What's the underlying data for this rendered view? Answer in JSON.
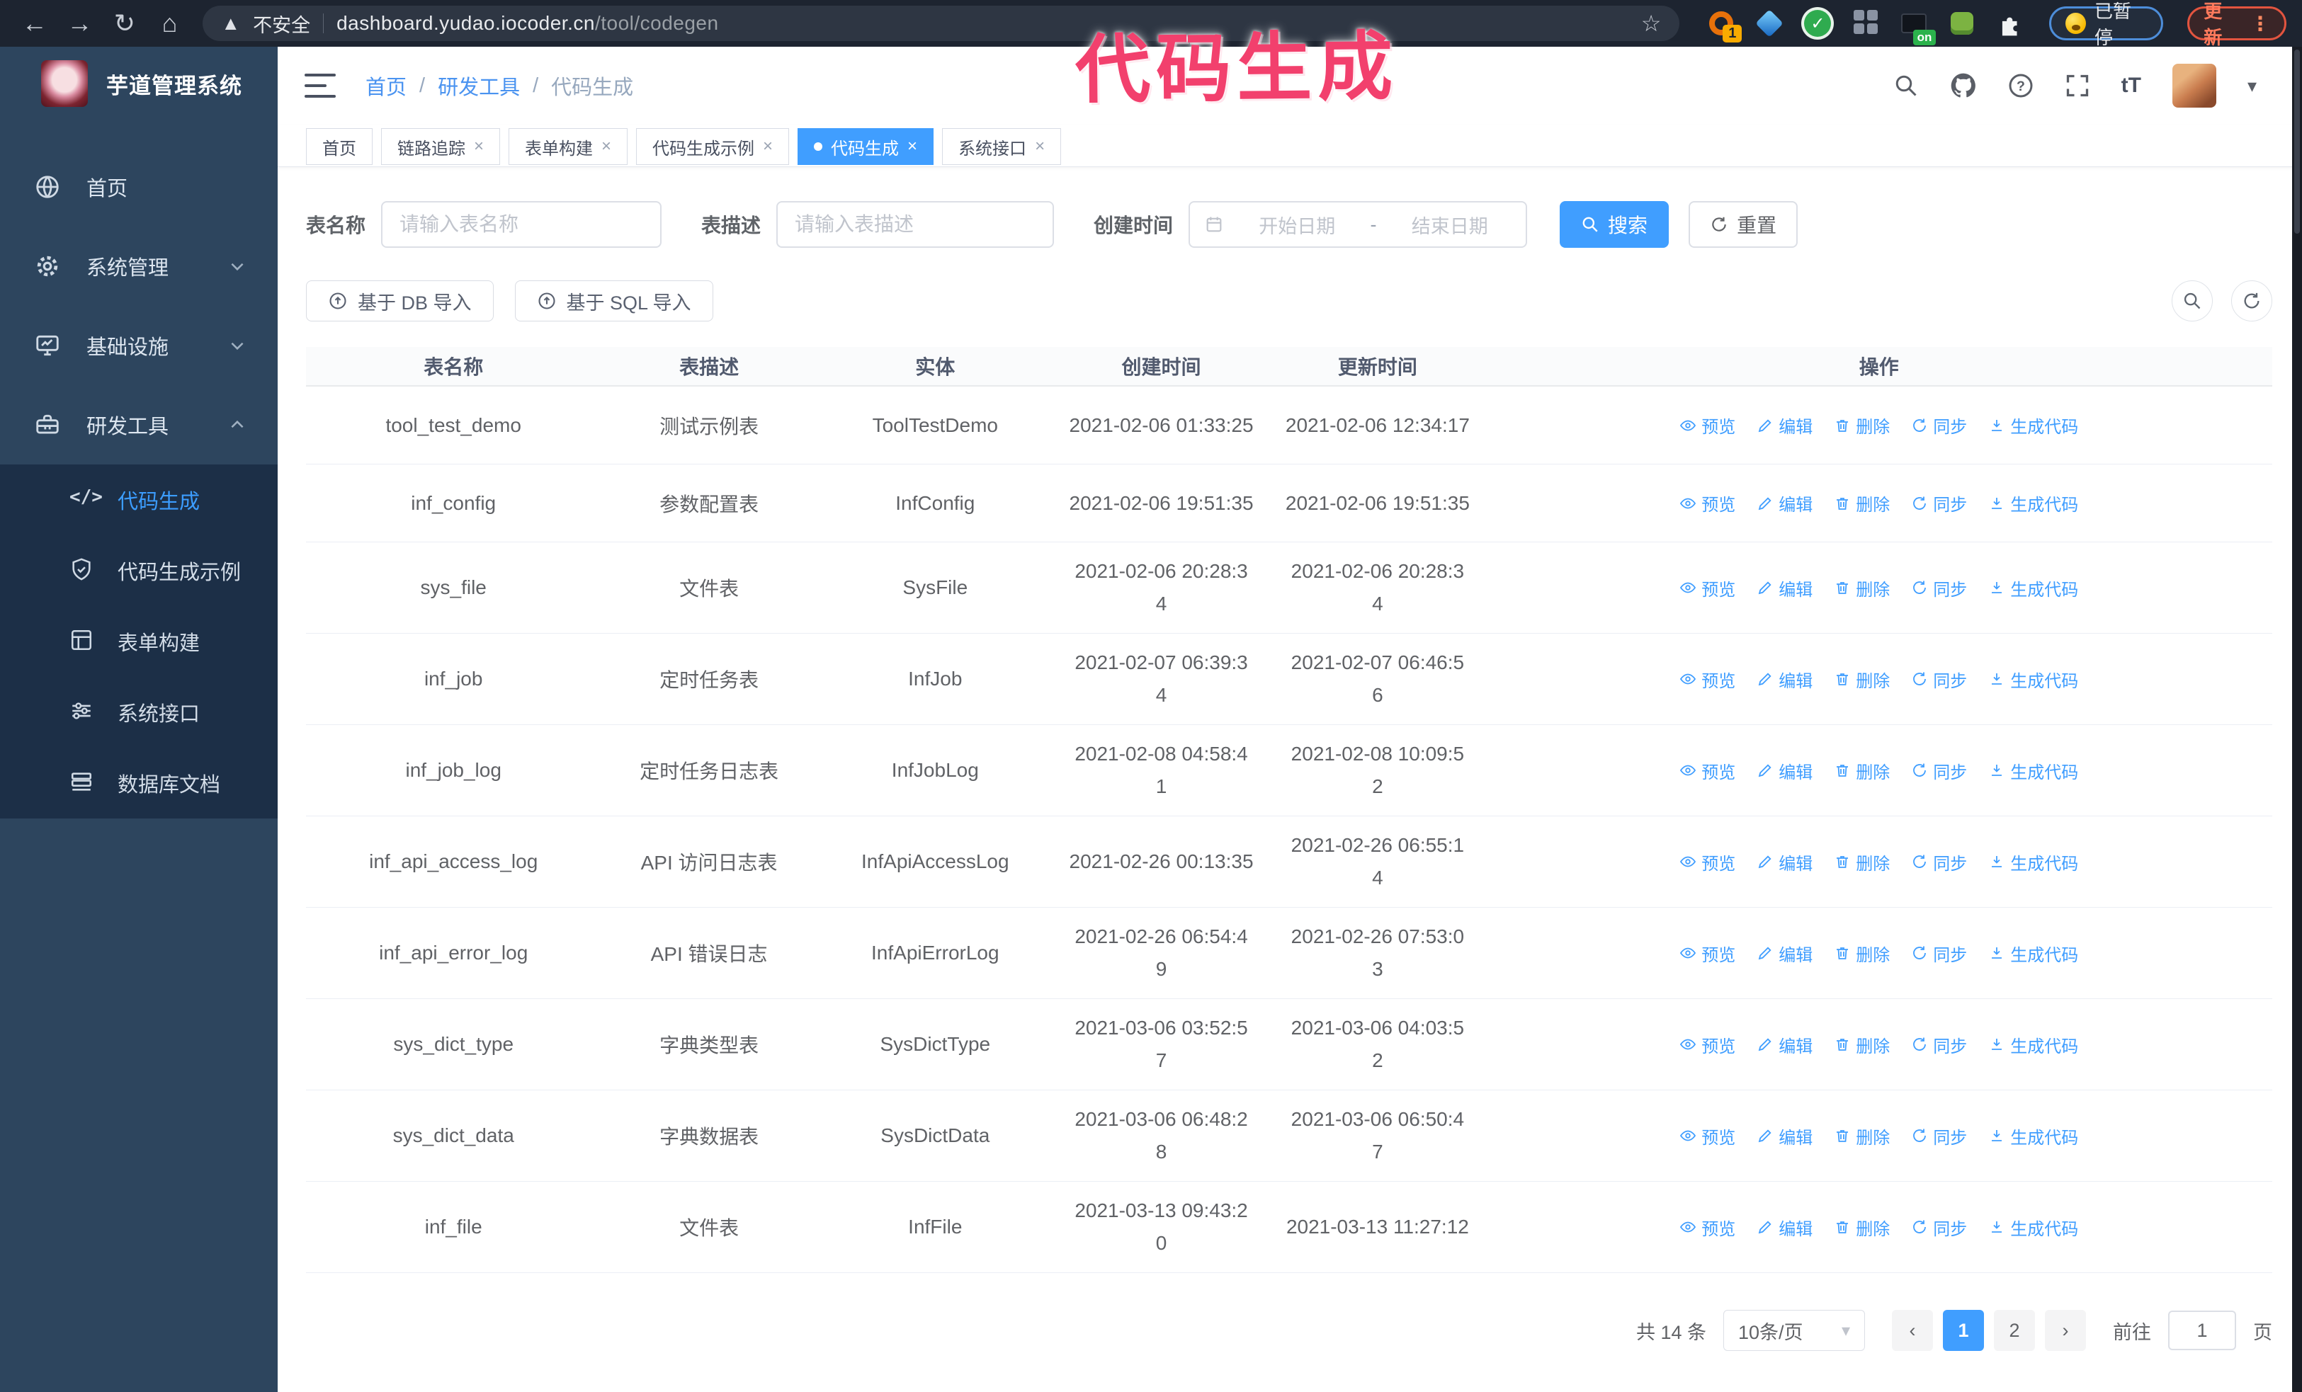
{
  "browser": {
    "security_label": "不安全",
    "url_host": "dashboard.yudao.iocoder.cn",
    "url_path": "/tool/codegen",
    "extension_badge": "1",
    "extension_on_badge": "on",
    "paused_badge": "已暂停",
    "update_button": "更新"
  },
  "annotation": {
    "text": "代码生成",
    "color": "#f2406d"
  },
  "sidebar": {
    "title": "芋道管理系统",
    "items": [
      {
        "label": "首页",
        "icon": "home-icon"
      },
      {
        "label": "系统管理",
        "icon": "gear-icon",
        "chevron": "down"
      },
      {
        "label": "基础设施",
        "icon": "monitor-icon",
        "chevron": "down"
      },
      {
        "label": "研发工具",
        "icon": "toolbox-icon",
        "chevron": "up",
        "expanded": true
      }
    ],
    "sub_items": [
      {
        "label": "代码生成",
        "icon": "code-icon",
        "active": true
      },
      {
        "label": "代码生成示例",
        "icon": "shield-icon",
        "active": false
      },
      {
        "label": "表单构建",
        "icon": "form-icon",
        "active": false
      },
      {
        "label": "系统接口",
        "icon": "sliders-icon",
        "active": false
      },
      {
        "label": "数据库文档",
        "icon": "database-icon",
        "active": false
      }
    ]
  },
  "header": {
    "breadcrumb": [
      "首页",
      "研发工具",
      "代码生成"
    ],
    "breadcrumb_sep": "/",
    "text_size_label": "tT"
  },
  "tabs": [
    {
      "label": "首页",
      "closable": false,
      "active": false
    },
    {
      "label": "链路追踪",
      "closable": true,
      "active": false
    },
    {
      "label": "表单构建",
      "closable": true,
      "active": false
    },
    {
      "label": "代码生成示例",
      "closable": true,
      "active": false
    },
    {
      "label": "代码生成",
      "closable": true,
      "active": true
    },
    {
      "label": "系统接口",
      "closable": true,
      "active": false
    }
  ],
  "filters": {
    "table_name_label": "表名称",
    "table_name_placeholder": "请输入表名称",
    "table_desc_label": "表描述",
    "table_desc_placeholder": "请输入表描述",
    "create_time_label": "创建时间",
    "date_start_placeholder": "开始日期",
    "date_sep": "-",
    "date_end_placeholder": "结束日期",
    "search_button": "搜索",
    "reset_button": "重置"
  },
  "toolbar": {
    "import_db": "基于 DB 导入",
    "import_sql": "基于 SQL 导入"
  },
  "table": {
    "columns": [
      "表名称",
      "表描述",
      "实体",
      "创建时间",
      "更新时间",
      "操作"
    ],
    "row_actions": [
      {
        "label": "预览",
        "icon": "eye-icon"
      },
      {
        "label": "编辑",
        "icon": "edit-icon"
      },
      {
        "label": "删除",
        "icon": "trash-icon"
      },
      {
        "label": "同步",
        "icon": "sync-icon"
      },
      {
        "label": "生成代码",
        "icon": "download-icon"
      }
    ],
    "rows": [
      {
        "name": "tool_test_demo",
        "desc": "测试示例表",
        "entity": "ToolTestDemo",
        "create": "2021-02-06 01:33:25",
        "update": "2021-02-06 12:34:17"
      },
      {
        "name": "inf_config",
        "desc": "参数配置表",
        "entity": "InfConfig",
        "create": "2021-02-06 19:51:35",
        "update": "2021-02-06 19:51:35"
      },
      {
        "name": "sys_file",
        "desc": "文件表",
        "entity": "SysFile",
        "create": "2021-02-06 20:28:3\n4",
        "update": "2021-02-06 20:28:3\n4"
      },
      {
        "name": "inf_job",
        "desc": "定时任务表",
        "entity": "InfJob",
        "create": "2021-02-07 06:39:3\n4",
        "update": "2021-02-07 06:46:5\n6"
      },
      {
        "name": "inf_job_log",
        "desc": "定时任务日志表",
        "entity": "InfJobLog",
        "create": "2021-02-08 04:58:4\n1",
        "update": "2021-02-08 10:09:5\n2"
      },
      {
        "name": "inf_api_access_log",
        "desc": "API 访问日志表",
        "entity": "InfApiAccessLog",
        "create": "2021-02-26 00:13:35",
        "update": "2021-02-26 06:55:1\n4"
      },
      {
        "name": "inf_api_error_log",
        "desc": "API 错误日志",
        "entity": "InfApiErrorLog",
        "create": "2021-02-26 06:54:4\n9",
        "update": "2021-02-26 07:53:0\n3"
      },
      {
        "name": "sys_dict_type",
        "desc": "字典类型表",
        "entity": "SysDictType",
        "create": "2021-03-06 03:52:5\n7",
        "update": "2021-03-06 04:03:5\n2"
      },
      {
        "name": "sys_dict_data",
        "desc": "字典数据表",
        "entity": "SysDictData",
        "create": "2021-03-06 06:48:2\n8",
        "update": "2021-03-06 06:50:4\n7"
      },
      {
        "name": "inf_file",
        "desc": "文件表",
        "entity": "InfFile",
        "create": "2021-03-13 09:43:2\n0",
        "update": "2021-03-13 11:27:12"
      }
    ]
  },
  "pagination": {
    "total": "共 14 条",
    "page_size": "10条/页",
    "pages": [
      "1",
      "2"
    ],
    "active_page": "1",
    "goto_label": "前往",
    "goto_value": "1",
    "page_suffix": "页"
  },
  "colors": {
    "accent": "#409eff",
    "annotation_pink": "#f2406d",
    "sidebar_bg": "#2d455e",
    "submenu_bg": "#1c2f47",
    "chrome_bg": "#1d2430"
  }
}
